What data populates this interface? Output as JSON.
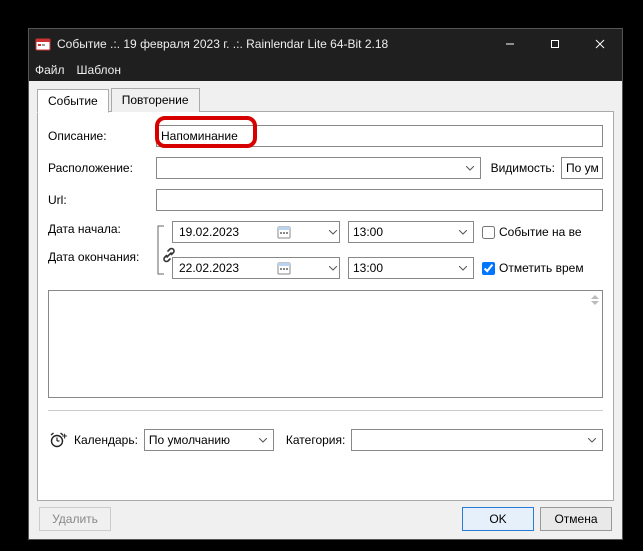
{
  "window": {
    "title": "Событие .:. 19 февраля 2023 г. .:. Rainlendar Lite 64-Bit 2.18"
  },
  "menu": {
    "file": "Файл",
    "template": "Шаблон"
  },
  "tabs": {
    "event": "Событие",
    "repeat": "Повторение"
  },
  "labels": {
    "description": "Описание:",
    "location": "Расположение:",
    "url": "Url:",
    "start_date": "Дата начала:",
    "end_date": "Дата окончания:",
    "visibility": "Видимость:",
    "all_day": "Событие на ве",
    "mark_time": "Отметить врем",
    "calendar": "Календарь:",
    "category": "Категория:"
  },
  "values": {
    "description": "Напоминание",
    "location": "",
    "url": "",
    "start_date": "19.02.2023",
    "end_date": "22.02.2023",
    "start_time": "13:00",
    "end_time": "13:00",
    "visibility": "По ум",
    "calendar": "По умолчанию",
    "category": "",
    "all_day_checked": false,
    "mark_time_checked": true
  },
  "buttons": {
    "delete": "Удалить",
    "ok": "OK",
    "cancel": "Отмена"
  }
}
